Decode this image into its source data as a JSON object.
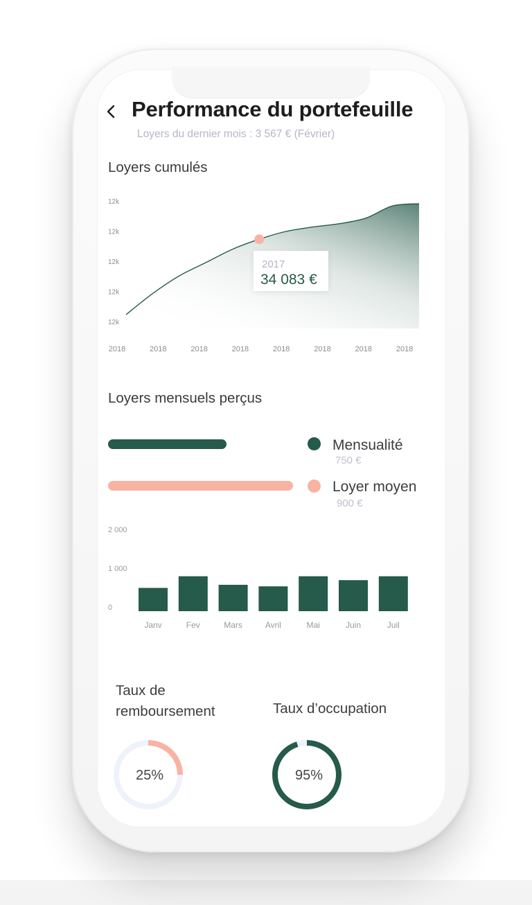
{
  "header": {
    "title": "Performance du portefeuille",
    "subtitle": "Loyers du dernier mois : 3 567 € (Février)"
  },
  "cumulative": {
    "title": "Loyers cumulés",
    "tooltip": {
      "year": "2017",
      "value": "34 083 €"
    }
  },
  "monthly": {
    "title": "Loyers mensuels perçus",
    "legend": [
      {
        "label": "Mensualité",
        "value": "750 €",
        "color": "#265a4b",
        "level": 0.57
      },
      {
        "label": "Loyer moyen",
        "value": "900 €",
        "color": "#f9b3a3",
        "level": 0.89
      }
    ]
  },
  "chart_data": [
    {
      "type": "area",
      "title": "Loyers cumulés",
      "y_tick_labels": [
        "12k",
        "12k",
        "12k",
        "12k",
        "12k"
      ],
      "x_tick_labels": [
        "2018",
        "2018",
        "2018",
        "2018",
        "2018",
        "2018",
        "2018",
        "2018"
      ],
      "series": [
        {
          "values": [
            0.0,
            0.19,
            0.35,
            0.47,
            0.59,
            0.68,
            0.75,
            0.79,
            0.82,
            0.87,
            0.98,
            1.0
          ]
        }
      ],
      "highlight": {
        "index": 5,
        "label": "2017",
        "value": "34 083 €"
      },
      "color": "#265a4b",
      "grid": false
    },
    {
      "type": "bar",
      "categories": [
        "Janv",
        "Fev",
        "Mars",
        "Avril",
        "Mai",
        "Juin",
        "Juil"
      ],
      "values": [
        600,
        900,
        680,
        640,
        900,
        800,
        900
      ],
      "ylim": [
        0,
        2000
      ],
      "y_ticks": [
        0,
        1000,
        2000
      ],
      "y_tick_labels": [
        "0",
        "1 000",
        "2 000"
      ],
      "color": "#265a4b",
      "grid": false
    },
    {
      "type": "pie",
      "title": "Taux de remboursement",
      "value": 25,
      "label": "25%",
      "color": "#f9b3a3",
      "track_color": "#eef2fb"
    },
    {
      "type": "pie",
      "title": "Taux d’occupation",
      "value": 95,
      "label": "95%",
      "color": "#265a4b",
      "track_color": "#eef2fb"
    }
  ]
}
